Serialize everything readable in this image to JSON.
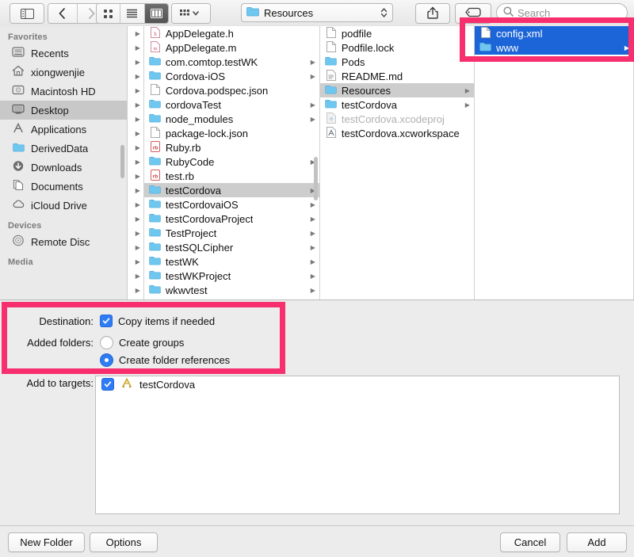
{
  "toolbar": {
    "sidebar_toggle": "sidebar-toggle",
    "back": "‹",
    "forward": "›",
    "view_icon": "icon-view",
    "view_list": "list-view",
    "view_column": "column-view",
    "group_by": "group-by",
    "path_label": "Resources",
    "share": "share",
    "tag": "tag",
    "search_placeholder": "Search"
  },
  "sidebar": {
    "sections": [
      {
        "title": "Favorites",
        "items": [
          {
            "label": "Recents",
            "icon": "recents-icon",
            "selected": false
          },
          {
            "label": "xiongwenjie",
            "icon": "home-icon",
            "selected": false
          },
          {
            "label": "Macintosh HD",
            "icon": "harddisk-icon",
            "selected": false
          },
          {
            "label": "Desktop",
            "icon": "desktop-icon",
            "selected": true
          },
          {
            "label": "Applications",
            "icon": "applications-icon",
            "selected": false
          },
          {
            "label": "DerivedData",
            "icon": "folder-icon",
            "selected": false
          },
          {
            "label": "Downloads",
            "icon": "downloads-icon",
            "selected": false
          },
          {
            "label": "Documents",
            "icon": "documents-icon",
            "selected": false
          },
          {
            "label": "iCloud Drive",
            "icon": "cloud-icon",
            "selected": false
          }
        ]
      },
      {
        "title": "Devices",
        "items": [
          {
            "label": "Remote Disc",
            "icon": "disc-icon",
            "selected": false
          }
        ]
      },
      {
        "title": "Media",
        "items": []
      }
    ]
  },
  "columns": [
    {
      "name": "column-desktop",
      "items": [
        {
          "label": "AppDelegate.h",
          "icon": "header-file-icon",
          "arrow": false,
          "selected": false,
          "dimmed": false
        },
        {
          "label": "AppDelegate.m",
          "icon": "objc-file-icon",
          "arrow": false,
          "selected": false,
          "dimmed": false
        },
        {
          "label": "com.comtop.testWK",
          "icon": "folder-icon",
          "arrow": true,
          "selected": false,
          "dimmed": false
        },
        {
          "label": "Cordova-iOS",
          "icon": "folder-icon",
          "arrow": true,
          "selected": false,
          "dimmed": false
        },
        {
          "label": "Cordova.podspec.json",
          "icon": "doc-icon",
          "arrow": false,
          "selected": false,
          "dimmed": false
        },
        {
          "label": "cordovaTest",
          "icon": "folder-icon",
          "arrow": true,
          "selected": false,
          "dimmed": false
        },
        {
          "label": "node_modules",
          "icon": "folder-icon",
          "arrow": true,
          "selected": false,
          "dimmed": false
        },
        {
          "label": "package-lock.json",
          "icon": "doc-icon",
          "arrow": false,
          "selected": false,
          "dimmed": false
        },
        {
          "label": "Ruby.rb",
          "icon": "ruby-file-icon",
          "arrow": false,
          "selected": false,
          "dimmed": false
        },
        {
          "label": "RubyCode",
          "icon": "folder-icon",
          "arrow": true,
          "selected": false,
          "dimmed": false
        },
        {
          "label": "test.rb",
          "icon": "ruby-file-icon",
          "arrow": false,
          "selected": false,
          "dimmed": false
        },
        {
          "label": "testCordova",
          "icon": "folder-icon",
          "arrow": true,
          "selected": true,
          "dimmed": false
        },
        {
          "label": "testCordovaiOS",
          "icon": "folder-icon",
          "arrow": true,
          "selected": false,
          "dimmed": false
        },
        {
          "label": "testCordovaProject",
          "icon": "folder-icon",
          "arrow": true,
          "selected": false,
          "dimmed": false
        },
        {
          "label": "TestProject",
          "icon": "folder-icon",
          "arrow": true,
          "selected": false,
          "dimmed": false
        },
        {
          "label": "testSQLCipher",
          "icon": "folder-icon",
          "arrow": true,
          "selected": false,
          "dimmed": false
        },
        {
          "label": "testWK",
          "icon": "folder-icon",
          "arrow": true,
          "selected": false,
          "dimmed": false
        },
        {
          "label": "testWKProject",
          "icon": "folder-icon",
          "arrow": true,
          "selected": false,
          "dimmed": false
        },
        {
          "label": "wkwvtest",
          "icon": "folder-icon",
          "arrow": true,
          "selected": false,
          "dimmed": false
        }
      ]
    },
    {
      "name": "column-testcordova",
      "items": [
        {
          "label": "podfile",
          "icon": "doc-icon",
          "arrow": false,
          "selected": false,
          "dimmed": false
        },
        {
          "label": "Podfile.lock",
          "icon": "doc-icon",
          "arrow": false,
          "selected": false,
          "dimmed": false
        },
        {
          "label": "Pods",
          "icon": "folder-icon",
          "arrow": false,
          "selected": false,
          "dimmed": false
        },
        {
          "label": "README.md",
          "icon": "text-file-icon",
          "arrow": false,
          "selected": false,
          "dimmed": false
        },
        {
          "label": "Resources",
          "icon": "folder-icon",
          "arrow": true,
          "selected": true,
          "dimmed": false
        },
        {
          "label": "testCordova",
          "icon": "folder-icon",
          "arrow": true,
          "selected": false,
          "dimmed": false
        },
        {
          "label": "testCordova.xcodeproj",
          "icon": "xcodeproj-icon",
          "arrow": false,
          "selected": false,
          "dimmed": true
        },
        {
          "label": "testCordova.xcworkspace",
          "icon": "xcworkspace-icon",
          "arrow": false,
          "selected": false,
          "dimmed": false
        }
      ]
    },
    {
      "name": "column-resources",
      "items": [
        {
          "label": "config.xml",
          "icon": "doc-icon",
          "arrow": false,
          "selected": false,
          "dimmed": false,
          "highlighted": true
        },
        {
          "label": "www",
          "icon": "folder-icon",
          "arrow": true,
          "selected": false,
          "dimmed": false,
          "highlighted": true
        }
      ]
    }
  ],
  "options": {
    "destination_label": "Destination:",
    "copy_items_label": "Copy items if needed",
    "copy_items_checked": true,
    "added_folders_label": "Added folders:",
    "create_groups_label": "Create groups",
    "create_groups_selected": false,
    "create_folder_refs_label": "Create folder references",
    "create_folder_refs_selected": true,
    "add_to_targets_label": "Add to targets:",
    "targets": [
      {
        "label": "testCordova",
        "checked": true,
        "icon": "xcode-target-icon"
      }
    ]
  },
  "footer": {
    "new_folder": "New Folder",
    "options": "Options",
    "cancel": "Cancel",
    "add": "Add"
  },
  "colors": {
    "annotation": "#f72f6e",
    "selection_blue": "#1c65d8",
    "control_blue": "#2f7cf6",
    "folder_blue": "#6fc6ee"
  }
}
